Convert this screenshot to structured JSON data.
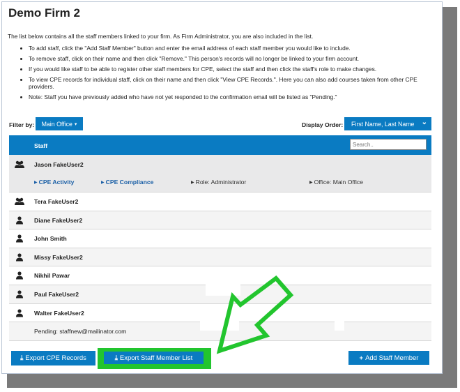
{
  "page": {
    "title": "Demo Firm 2",
    "intro": "The list below contains all the staff members linked to your firm. As Firm Administrator, you are also included in the list."
  },
  "instructions": [
    "To add staff, click the \"Add Staff Member\" button and enter the email address of each staff member you would like to include.",
    "To remove staff, click on their name and then click \"Remove.\" This person's records will no longer be linked to your firm account.",
    "If you would like staff to be able to register other staff members for CPE, select the staff and then click the staff's role to make changes.",
    "To view CPE records for individual staff, click on their name and then click \"View CPE Records.\". Here you can also add courses taken from other CPE providers.",
    "Note: Staff you have previously added who have not yet responded to the confirmation email will be listed as \"Pending.\""
  ],
  "filter": {
    "label": "Filter by:",
    "value": "Main Office"
  },
  "display_order": {
    "label": "Display Order:",
    "value": "First Name, Last Name"
  },
  "table": {
    "header": "Staff",
    "search_placeholder": "Search..",
    "expanded": {
      "name": "Jason FakeUser2",
      "cpe_activity": "CPE Activity",
      "cpe_compliance": "CPE Compliance",
      "role": "Role: Administrator",
      "office": "Office: Main Office"
    },
    "rows": [
      {
        "name": "Tera FakeUser2",
        "icon": "group-icon"
      },
      {
        "name": "Diane FakeUser2",
        "icon": "user-icon"
      },
      {
        "name": "John Smith",
        "icon": "user-icon"
      },
      {
        "name": "Missy FakeUser2",
        "icon": "user-icon"
      },
      {
        "name": "Nikhil Pawar",
        "icon": "user-icon"
      },
      {
        "name": "Paul FakeUser2",
        "icon": "user-icon"
      },
      {
        "name": "Walter FakeUser2",
        "icon": "user-icon"
      }
    ],
    "pending": "Pending: staffnew@mailinator.com"
  },
  "buttons": {
    "export_cpe": "Export CPE Records",
    "export_staff": "Export Staff Member List",
    "add_staff": "Add Staff Member"
  },
  "colors": {
    "accent": "#0a7bc2",
    "highlight": "#22c52e",
    "link": "#1a5fa6"
  }
}
